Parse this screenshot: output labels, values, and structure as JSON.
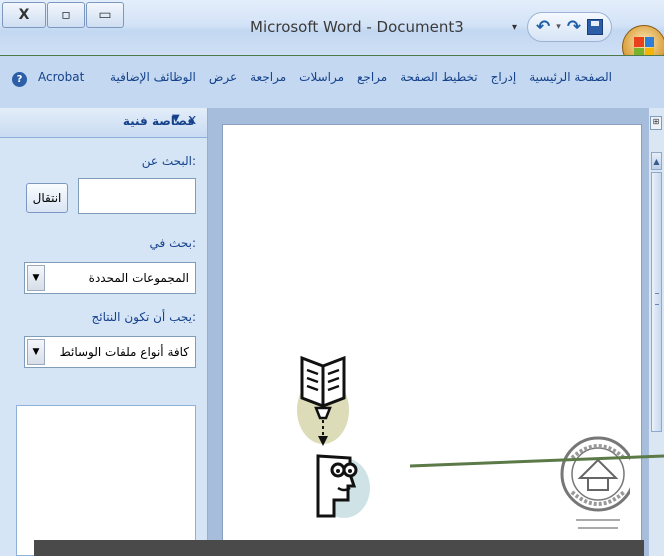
{
  "window": {
    "title": "Microsoft Word - Document3",
    "controls": [
      "X",
      "▫",
      "▭"
    ]
  },
  "quick_access": {
    "dropdown": "▾",
    "undo": "↶",
    "redo": "↷",
    "save_icon": "save-icon"
  },
  "ribbon": {
    "tabs": [
      "الصفحة الرئيسية",
      "إدراج",
      "تخطيط الصفحة",
      "مراجع",
      "مراسلات",
      "مراجعة",
      "عرض",
      "الوظائف الإضافية",
      "Acrobat"
    ],
    "help": "?"
  },
  "task_pane": {
    "title": "قصاصة فنية",
    "search_label": "البحث عن:",
    "search_value": "",
    "go_button": "انتقال",
    "search_in_label": "بحث في:",
    "search_in_value": "المجموعات المحددة",
    "results_label": "يجب أن تكون النتائج:",
    "results_value": "كافة أنواع ملفات الوسائط"
  },
  "colors": {
    "ribbon_bg": "#c4d9f1",
    "accent": "#15428b",
    "green_line": "#4d7a48"
  }
}
